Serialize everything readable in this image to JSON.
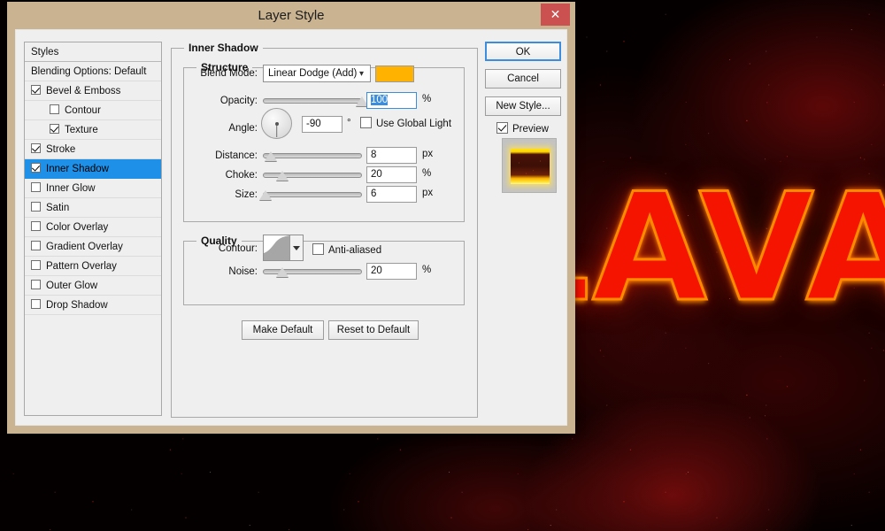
{
  "window": {
    "title": "Layer Style",
    "close_label": "✕"
  },
  "styles_panel": {
    "header": "Styles",
    "items": [
      {
        "label": "Blending Options: Default",
        "checkbox": false,
        "checked": false,
        "indent": false,
        "selected": false
      },
      {
        "label": "Bevel & Emboss",
        "checkbox": true,
        "checked": true,
        "indent": false,
        "selected": false
      },
      {
        "label": "Contour",
        "checkbox": true,
        "checked": false,
        "indent": true,
        "selected": false
      },
      {
        "label": "Texture",
        "checkbox": true,
        "checked": true,
        "indent": true,
        "selected": false
      },
      {
        "label": "Stroke",
        "checkbox": true,
        "checked": true,
        "indent": false,
        "selected": false
      },
      {
        "label": "Inner Shadow",
        "checkbox": true,
        "checked": true,
        "indent": false,
        "selected": true
      },
      {
        "label": "Inner Glow",
        "checkbox": true,
        "checked": false,
        "indent": false,
        "selected": false
      },
      {
        "label": "Satin",
        "checkbox": true,
        "checked": false,
        "indent": false,
        "selected": false
      },
      {
        "label": "Color Overlay",
        "checkbox": true,
        "checked": false,
        "indent": false,
        "selected": false
      },
      {
        "label": "Gradient Overlay",
        "checkbox": true,
        "checked": false,
        "indent": false,
        "selected": false
      },
      {
        "label": "Pattern Overlay",
        "checkbox": true,
        "checked": false,
        "indent": false,
        "selected": false
      },
      {
        "label": "Outer Glow",
        "checkbox": true,
        "checked": false,
        "indent": false,
        "selected": false
      },
      {
        "label": "Drop Shadow",
        "checkbox": true,
        "checked": false,
        "indent": false,
        "selected": false
      }
    ]
  },
  "panel": {
    "group_title": "Inner Shadow",
    "structure": {
      "title": "Structure",
      "blend_mode_label": "Blend Mode:",
      "blend_mode_value": "Linear Dodge (Add)",
      "color_swatch": "#ffb300",
      "opacity_label": "Opacity:",
      "opacity_value": "100",
      "opacity_unit": "%",
      "opacity_pct": 100,
      "angle_label": "Angle:",
      "angle_value": "-90",
      "angle_unit": "°",
      "use_global_light_label": "Use Global Light",
      "use_global_light_checked": false,
      "distance_label": "Distance:",
      "distance_value": "8",
      "distance_unit": "px",
      "distance_pct": 8,
      "choke_label": "Choke:",
      "choke_value": "20",
      "choke_unit": "%",
      "choke_pct": 20,
      "size_label": "Size:",
      "size_value": "6",
      "size_unit": "px",
      "size_pct": 3
    },
    "quality": {
      "title": "Quality",
      "contour_label": "Contour:",
      "anti_aliased_label": "Anti-aliased",
      "anti_aliased_checked": false,
      "noise_label": "Noise:",
      "noise_value": "20",
      "noise_unit": "%",
      "noise_pct": 20
    },
    "make_default_label": "Make Default",
    "reset_to_default_label": "Reset to Default"
  },
  "buttons": {
    "ok": "OK",
    "cancel": "Cancel",
    "new_style": "New Style...",
    "preview_label": "Preview",
    "preview_checked": true
  },
  "background": {
    "artwork_text": "LAVA",
    "text_color": "#f51400",
    "glow_color": "#ff8a00"
  }
}
